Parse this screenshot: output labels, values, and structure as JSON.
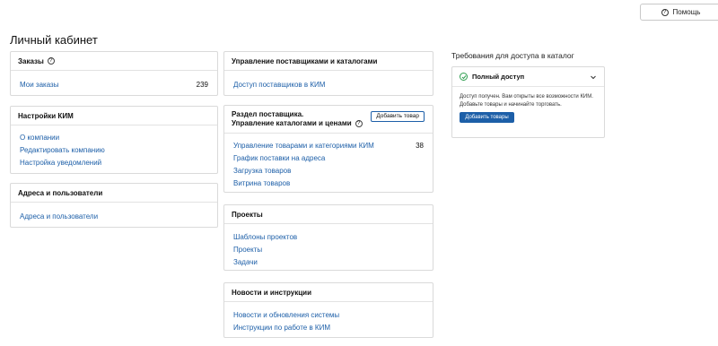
{
  "header": {
    "help_label": "Помощь"
  },
  "page_title": "Личный кабинет",
  "orders": {
    "title": "Заказы",
    "items": [
      {
        "label": "Мои заказы",
        "count": "239"
      }
    ]
  },
  "kim_settings": {
    "title": "Настройки КИМ",
    "items": [
      "О компании",
      "Редактировать компанию",
      "Настройка уведомлений"
    ]
  },
  "addresses": {
    "title": "Адреса и пользователи",
    "items": [
      "Адреса и пользователи"
    ]
  },
  "suppliers": {
    "title": "Управление поставщиками и каталогами",
    "items": [
      "Доступ поставщиков в КИМ"
    ]
  },
  "supplier_section": {
    "title_line1": "Раздел поставщика.",
    "title_line2": "Управление каталогами и ценами",
    "add_button": "Добавить товар",
    "items": [
      {
        "label": "Управление товарами и категориями КИМ",
        "count": "38"
      },
      {
        "label": "График поставки на адреса",
        "count": ""
      },
      {
        "label": "Загрузка товаров",
        "count": ""
      },
      {
        "label": "Витрина товаров",
        "count": ""
      }
    ]
  },
  "projects": {
    "title": "Проекты",
    "items": [
      "Шаблоны проектов",
      "Проекты",
      "Задачи"
    ]
  },
  "news": {
    "title": "Новости и инструкции",
    "items": [
      "Новости и обновления системы",
      "Инструкции по работе в КИМ"
    ]
  },
  "access": {
    "section_title": "Требования для доступа в каталог",
    "status": "Полный доступ",
    "description": "Доступ получен. Вам открыты все возможности КИМ. Добавьте товары и начинайте торговать.",
    "button": "Добавить товары"
  },
  "colors": {
    "link": "#1d5fa8",
    "success": "#2e9e4f",
    "primary": "#1d5fa8"
  }
}
